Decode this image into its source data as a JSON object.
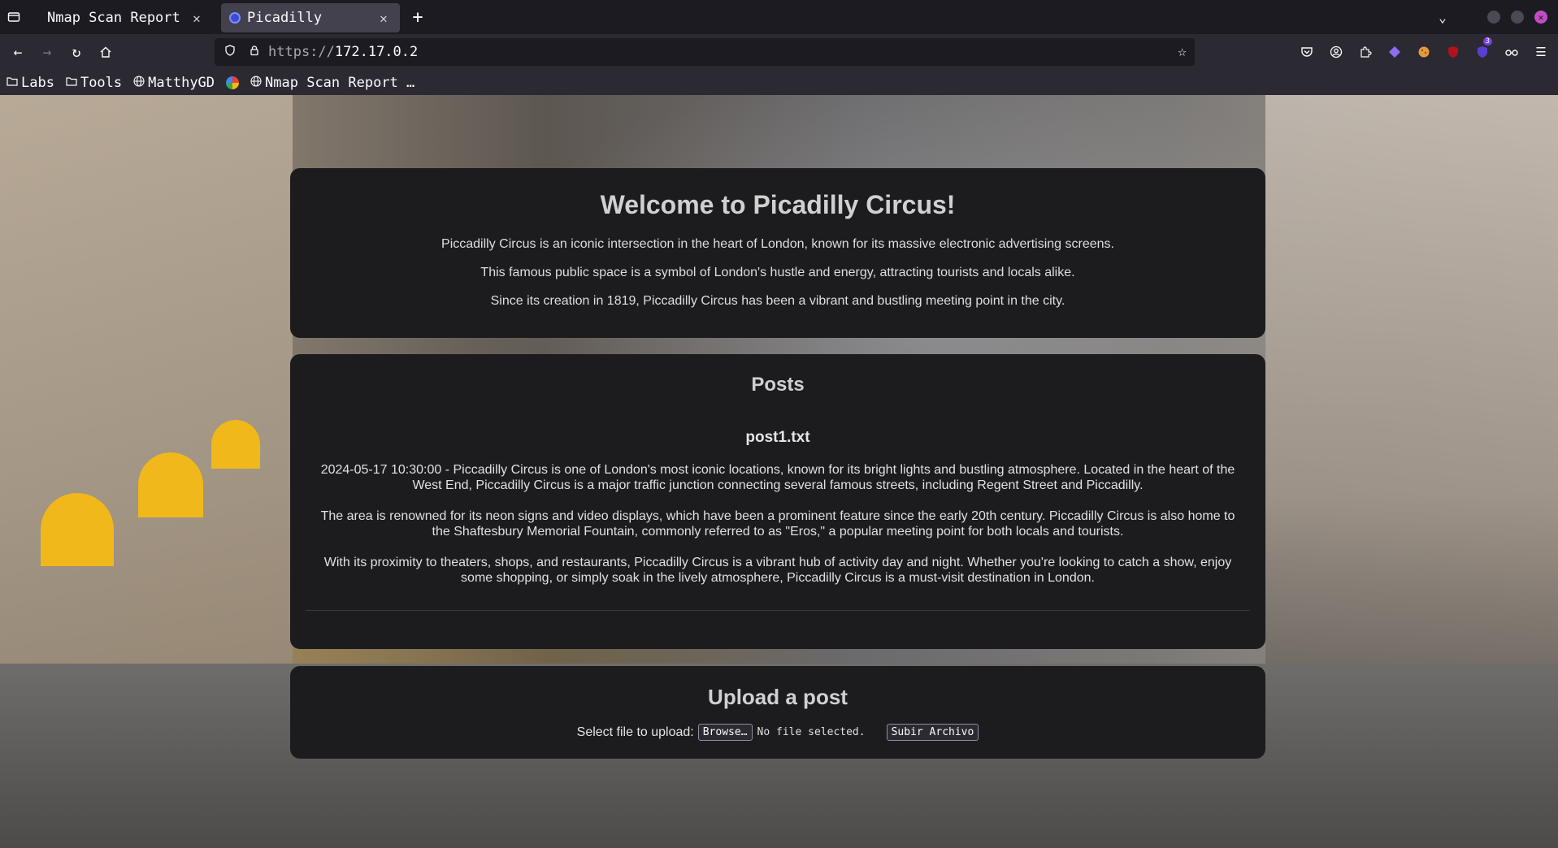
{
  "tabs": [
    {
      "title": "Nmap Scan Report -",
      "active": false
    },
    {
      "title": "Picadilly",
      "active": true
    }
  ],
  "address_bar": {
    "scheme": "https://",
    "host": "172.17.0.2"
  },
  "bookmarks": [
    {
      "label": "Labs",
      "icon": "folder-icon"
    },
    {
      "label": "Tools",
      "icon": "folder-icon"
    },
    {
      "label": "MatthyGD",
      "icon": "globe-icon"
    },
    {
      "label": "",
      "icon": "google-icon"
    },
    {
      "label": "Nmap Scan Report …",
      "icon": "globe-icon"
    }
  ],
  "extensions": {
    "badge_count": "3"
  },
  "welcome": {
    "title": "Welcome to Picadilly Circus!",
    "paragraphs": [
      "Piccadilly Circus is an iconic intersection in the heart of London, known for its massive electronic advertising screens.",
      "This famous public space is a symbol of London's hustle and energy, attracting tourists and locals alike.",
      "Since its creation in 1819, Piccadilly Circus has been a vibrant and bustling meeting point in the city."
    ]
  },
  "posts": {
    "heading": "Posts",
    "items": [
      {
        "filename": "post1.txt",
        "paragraphs": [
          "2024-05-17 10:30:00 - Piccadilly Circus is one of London's most iconic locations, known for its bright lights and bustling atmosphere. Located in the heart of the West End, Piccadilly Circus is a major traffic junction connecting several famous streets, including Regent Street and Piccadilly.",
          "The area is renowned for its neon signs and video displays, which have been a prominent feature since the early 20th century. Piccadilly Circus is also home to the Shaftesbury Memorial Fountain, commonly referred to as \"Eros,\" a popular meeting point for both locals and tourists.",
          "With its proximity to theaters, shops, and restaurants, Piccadilly Circus is a vibrant hub of activity day and night. Whether you're looking to catch a show, enjoy some shopping, or simply soak in the lively atmosphere, Piccadilly Circus is a must-visit destination in London."
        ]
      }
    ]
  },
  "upload": {
    "heading": "Upload a post",
    "select_label": "Select file to upload:",
    "browse_label": "Browse…",
    "file_status": "No file selected.",
    "submit_label": "Subir Archivo"
  }
}
